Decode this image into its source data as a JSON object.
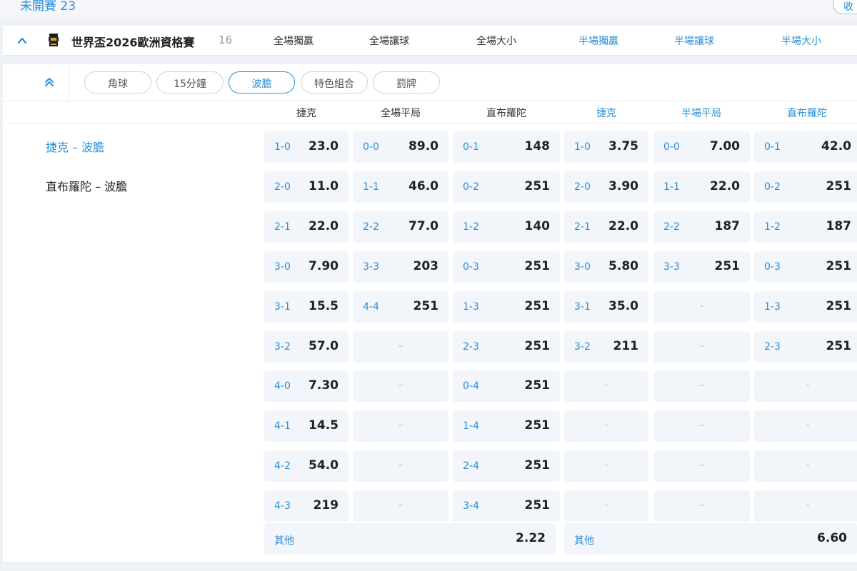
{
  "header": {
    "title": "未開賽 23",
    "collapse_label": "收"
  },
  "league": {
    "name": "世界盃2026歐洲資格賽",
    "count": "16",
    "markets": [
      {
        "label": "全場獨贏",
        "color": "#333333"
      },
      {
        "label": "全場讓球",
        "color": "#333333"
      },
      {
        "label": "全場大小",
        "color": "#333333"
      },
      {
        "label": "半場獨贏",
        "color": "#2b8fd6"
      },
      {
        "label": "半場讓球",
        "color": "#2b8fd6"
      },
      {
        "label": "半場大小",
        "color": "#2b8fd6"
      }
    ]
  },
  "subtabs": [
    {
      "label": "角球",
      "active": false
    },
    {
      "label": "15分鐘",
      "active": false
    },
    {
      "label": "波膽",
      "active": true
    },
    {
      "label": "特色組合",
      "active": false
    },
    {
      "label": "罰牌",
      "active": false
    }
  ],
  "column_headers": {
    "full": [
      "捷克",
      "全場平局",
      "直布羅陀"
    ],
    "half": [
      "捷克",
      "半場平局",
      "直布羅陀"
    ]
  },
  "matches": [
    {
      "label": "捷克 – 波膽",
      "active": true
    },
    {
      "label": "直布羅陀 – 波膽",
      "active": false
    }
  ],
  "odds": {
    "full_home": [
      {
        "score": "1-0",
        "odds": "23.0"
      },
      {
        "score": "2-0",
        "odds": "11.0"
      },
      {
        "score": "2-1",
        "odds": "22.0"
      },
      {
        "score": "3-0",
        "odds": "7.90"
      },
      {
        "score": "3-1",
        "odds": "15.5"
      },
      {
        "score": "3-2",
        "odds": "57.0"
      },
      {
        "score": "4-0",
        "odds": "7.30"
      },
      {
        "score": "4-1",
        "odds": "14.5"
      },
      {
        "score": "4-2",
        "odds": "54.0"
      },
      {
        "score": "4-3",
        "odds": "219"
      }
    ],
    "full_draw": [
      {
        "score": "0-0",
        "odds": "89.0"
      },
      {
        "score": "1-1",
        "odds": "46.0"
      },
      {
        "score": "2-2",
        "odds": "77.0"
      },
      {
        "score": "3-3",
        "odds": "203"
      },
      {
        "score": "4-4",
        "odds": "251"
      },
      {
        "dash": "–"
      },
      {
        "dash": "–"
      },
      {
        "dash": "–"
      },
      {
        "dash": "–"
      },
      {
        "dash": "–"
      }
    ],
    "full_away": [
      {
        "score": "0-1",
        "odds": "148"
      },
      {
        "score": "0-2",
        "odds": "251"
      },
      {
        "score": "1-2",
        "odds": "140"
      },
      {
        "score": "0-3",
        "odds": "251"
      },
      {
        "score": "1-3",
        "odds": "251"
      },
      {
        "score": "2-3",
        "odds": "251"
      },
      {
        "score": "0-4",
        "odds": "251"
      },
      {
        "score": "1-4",
        "odds": "251"
      },
      {
        "score": "2-4",
        "odds": "251"
      },
      {
        "score": "3-4",
        "odds": "251"
      }
    ],
    "half_home": [
      {
        "score": "1-0",
        "odds": "3.75"
      },
      {
        "score": "2-0",
        "odds": "3.90"
      },
      {
        "score": "2-1",
        "odds": "22.0"
      },
      {
        "score": "3-0",
        "odds": "5.80"
      },
      {
        "score": "3-1",
        "odds": "35.0"
      },
      {
        "score": "3-2",
        "odds": "211"
      },
      {
        "dash": "-"
      },
      {
        "dash": "-"
      },
      {
        "dash": "-"
      },
      {
        "dash": "-"
      }
    ],
    "half_draw": [
      {
        "score": "0-0",
        "odds": "7.00"
      },
      {
        "score": "1-1",
        "odds": "22.0"
      },
      {
        "score": "2-2",
        "odds": "187"
      },
      {
        "score": "3-3",
        "odds": "251"
      },
      {
        "dash": "-"
      },
      {
        "dash": "–"
      },
      {
        "dash": "–"
      },
      {
        "dash": "–"
      },
      {
        "dash": "–"
      },
      {
        "dash": "–"
      }
    ],
    "half_away": [
      {
        "score": "0-1",
        "odds": "42.0"
      },
      {
        "score": "0-2",
        "odds": "251"
      },
      {
        "score": "1-2",
        "odds": "187"
      },
      {
        "score": "0-3",
        "odds": "251"
      },
      {
        "score": "1-3",
        "odds": "251"
      },
      {
        "score": "2-3",
        "odds": "251"
      },
      {
        "dash": "-"
      },
      {
        "dash": "-"
      },
      {
        "dash": "-"
      },
      {
        "dash": "-"
      }
    ],
    "other_full": {
      "label": "其他",
      "odds": "2.22"
    },
    "other_half": {
      "label": "其他",
      "odds": "6.60"
    }
  },
  "colors": {
    "accent": "#2b8fd6",
    "cell_bg": "#f2f5fa",
    "page_bg": "#eef1f6"
  },
  "icons": {
    "league_toggle": "chevron-up-icon",
    "league_logo": "trophy-icon",
    "subtab_toggle": "double-chevron-up-icon"
  }
}
